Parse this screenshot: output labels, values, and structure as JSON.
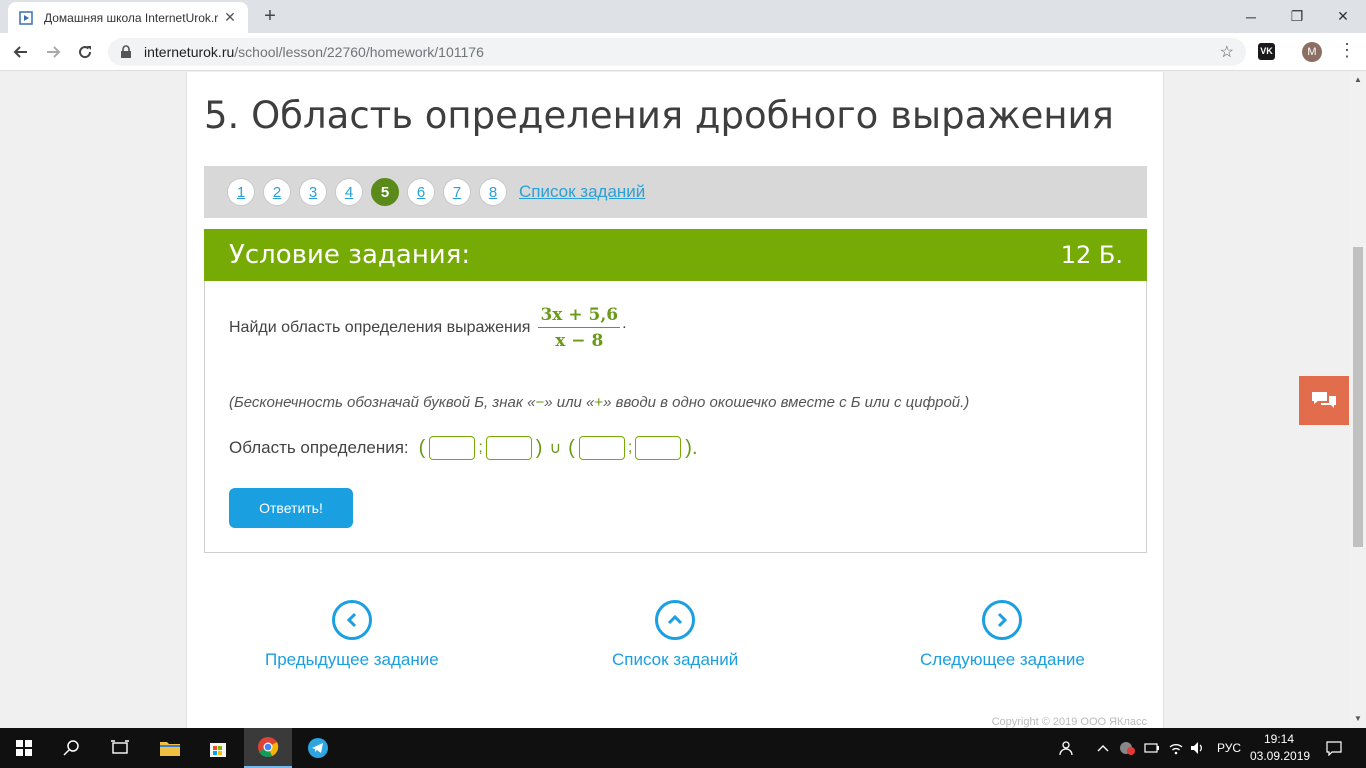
{
  "browser": {
    "tab_title": "Домашняя школа InternetUrok.r",
    "url_domain": "internetu­rok.ru",
    "url_path": "/school/lesson/22760/homework/101176",
    "profile_initial": "M",
    "vk_label": "VK"
  },
  "lesson": {
    "title": "5. Область определения дробного выражения"
  },
  "pager": {
    "pages": [
      "1",
      "2",
      "3",
      "4",
      "5",
      "6",
      "7",
      "8"
    ],
    "active": "5",
    "list_link": "Список заданий"
  },
  "task": {
    "header": "Условие задания:",
    "points": "12 Б.",
    "question": "Найди область определения выражения",
    "fraction_num": "3x + 5,6",
    "fraction_den": "x − 8",
    "hint_before": "(Бесконечность обозначай буквой Б, знак «",
    "hint_minus": "−",
    "hint_mid": "» или «",
    "hint_plus": "+",
    "hint_after": "» вводи в одно окошечко вместе с Б или с цифрой.)",
    "domain_label": "Область определения:",
    "union_symbol": "∪",
    "answer_button": "Ответить!"
  },
  "navigation": {
    "prev": "Предыдущее задание",
    "list": "Список заданий",
    "next": "Следующее задание"
  },
  "footer": {
    "copyright": "Copyright © 2019 ООО ЯКласс"
  },
  "taskbar": {
    "lang": "РУС",
    "time": "19:14",
    "date": "03.09.2019"
  },
  "colors": {
    "accent_green": "#76ab05",
    "link_blue": "#1a9fe0",
    "chat_orange": "#e16d4c"
  }
}
